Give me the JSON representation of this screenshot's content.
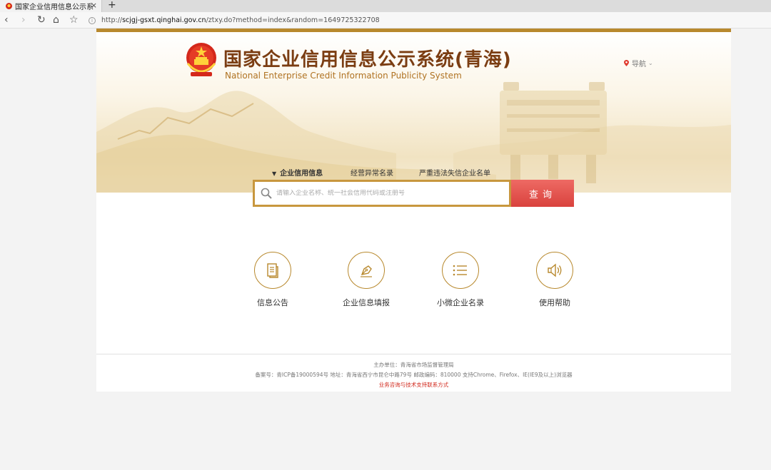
{
  "browser": {
    "tab_title": "国家企业信用信息公示系统",
    "tab_close": "×",
    "new_tab": "+",
    "url_prefix": "http://",
    "url_host": "scjgj-gsxt.qinghai.gov.cn",
    "url_path": "/ztxy.do?method=index&random=1649725322708"
  },
  "header": {
    "title": "国家企业信用信息公示系统(青海)",
    "subtitle": "National Enterprise Credit Information Publicity System",
    "nav_label": "导航"
  },
  "search": {
    "tabs": [
      {
        "label": "企业信用信息",
        "active": true
      },
      {
        "label": "经营异常名录",
        "active": false
      },
      {
        "label": "严重违法失信企业名单",
        "active": false
      }
    ],
    "placeholder": "请输入企业名称、统一社会信用代码或注册号",
    "button_label": "查询"
  },
  "features": [
    {
      "label": "信息公告",
      "icon": "document-icon"
    },
    {
      "label": "企业信息填报",
      "icon": "pen-icon"
    },
    {
      "label": "小微企业名录",
      "icon": "list-icon"
    },
    {
      "label": "使用帮助",
      "icon": "speaker-icon"
    }
  ],
  "footer": {
    "sponsor": "主办单位：青海省市场监督管理局",
    "record": "备案号：青ICP备19000594号 地址：青海省西宁市昆仑中路79号    邮政编码：810000 支持Chrome、Firefox、IE(IE9及以上)浏览器",
    "support_link": "业务咨询与技术支持联系方式"
  },
  "colors": {
    "gold": "#b8892e",
    "title_brown": "#7b3d12",
    "button_red": "#e0504a",
    "link_red": "#d22a1e"
  }
}
